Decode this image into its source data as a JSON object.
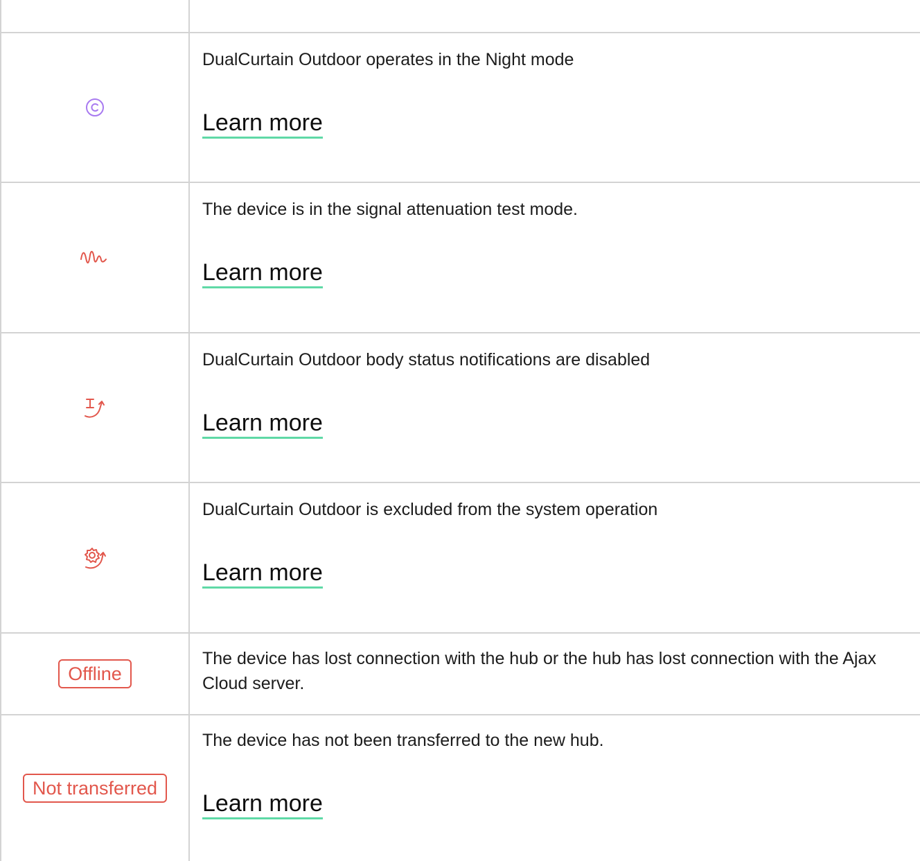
{
  "colors": {
    "border": "#d3d3d3",
    "link_underline": "#5fd9a6",
    "alert": "#e2574c",
    "night_mode": "#a87af0"
  },
  "rows": [
    {
      "icon": "night-mode-icon",
      "description": "DualCurtain Outdoor operates in the Night mode",
      "link": "Learn more"
    },
    {
      "icon": "signal-attenuation-icon",
      "description": "The device is in the signal attenuation test mode.",
      "link": "Learn more"
    },
    {
      "icon": "body-notifications-disabled-icon",
      "description": "DualCurtain Outdoor body status notifications are disabled",
      "link": "Learn more"
    },
    {
      "icon": "excluded-from-system-icon",
      "description": "DualCurtain Outdoor is excluded from the system operation",
      "link": "Learn more"
    },
    {
      "badge": "Offline",
      "description": "The device has lost connection with the hub or the hub has lost connection with the Ajax Cloud server."
    },
    {
      "badge": "Not transferred",
      "description": "The device has not been transferred to the new hub.",
      "link": "Learn more"
    }
  ]
}
